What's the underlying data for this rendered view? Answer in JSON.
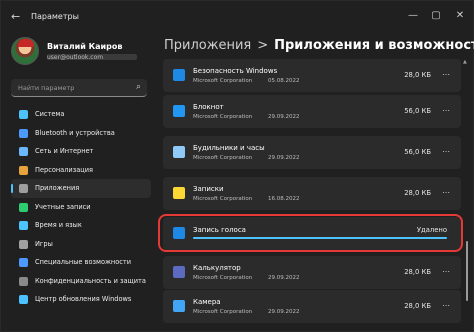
{
  "window": {
    "title": "Параметры",
    "back_icon": "back-arrow-icon",
    "controls": [
      "minimize",
      "maximize",
      "close"
    ]
  },
  "profile": {
    "name": "Виталий Каиров",
    "email": "user@outlook.com"
  },
  "search": {
    "placeholder": "Найти параметр",
    "icon": "search-icon"
  },
  "nav": {
    "items": [
      {
        "label": "Система",
        "icon": "system-icon",
        "color": "#4cc2ff"
      },
      {
        "label": "Bluetooth и устройства",
        "icon": "bluetooth-icon",
        "color": "#4c9aff"
      },
      {
        "label": "Сеть и Интернет",
        "icon": "network-icon",
        "color": "#6ab7ff"
      },
      {
        "label": "Персонализация",
        "icon": "personalization-icon",
        "color": "#e6a23c"
      },
      {
        "label": "Приложения",
        "icon": "apps-icon",
        "color": "#9e9e9e",
        "active": true
      },
      {
        "label": "Учетные записи",
        "icon": "accounts-icon",
        "color": "#2ecc71"
      },
      {
        "label": "Время и язык",
        "icon": "time-language-icon",
        "color": "#4cc2ff"
      },
      {
        "label": "Игры",
        "icon": "gaming-icon",
        "color": "#a0a0a0"
      },
      {
        "label": "Специальные возможности",
        "icon": "accessibility-icon",
        "color": "#4c9aff"
      },
      {
        "label": "Конфиденциальность и защита",
        "icon": "shield-icon",
        "color": "#8a8a8a"
      },
      {
        "label": "Центр обновления Windows",
        "icon": "update-icon",
        "color": "#4cc2ff"
      }
    ]
  },
  "breadcrumb": {
    "first": "Приложения",
    "separator": ">",
    "current": "Приложения и возможности"
  },
  "apps": [
    {
      "name": "Безопасность Windows",
      "publisher": "Microsoft Corporation",
      "date": "05.08.2022",
      "size": "28,0 КБ",
      "icon": "windows-security-icon",
      "color": "#1e88e5"
    },
    {
      "name": "Блокнот",
      "publisher": "Microsoft Corporation",
      "date": "29.09.2022",
      "size": "56,0 КБ",
      "icon": "notepad-icon",
      "color": "#2196f3"
    },
    {
      "name": "Будильники и часы",
      "publisher": "Microsoft Corporation",
      "date": "29.09.2022",
      "size": "56,0 КБ",
      "icon": "alarms-clock-icon",
      "color": "#90caf9"
    },
    {
      "name": "Записки",
      "publisher": "Microsoft Corporation",
      "date": "16.08.2022",
      "size": "28,0 КБ",
      "icon": "sticky-notes-icon",
      "color": "#fdd835"
    },
    {
      "name": "Запись голоса",
      "status": "Удалено",
      "icon": "voice-recorder-icon",
      "color": "#1e88e5",
      "progress": 1.0
    },
    {
      "name": "Калькулятор",
      "publisher": "Microsoft Corporation",
      "date": "29.09.2022",
      "size": "28,0 КБ",
      "icon": "calculator-icon",
      "color": "#5c6bc0"
    },
    {
      "name": "Камера",
      "publisher": "Microsoft Corporation",
      "date": "29.09.2022",
      "size": "28,0 КБ",
      "icon": "camera-icon",
      "color": "#42a5f5"
    }
  ]
}
